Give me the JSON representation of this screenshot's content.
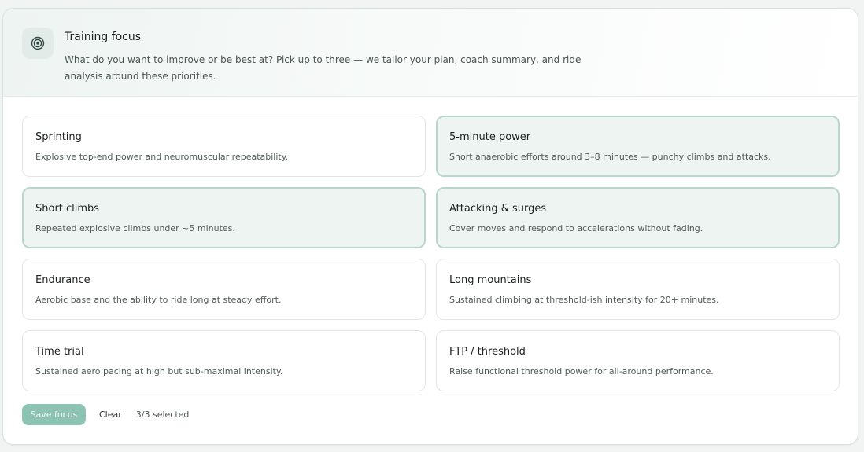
{
  "header": {
    "icon": "target-icon",
    "title": "Training focus",
    "description": "What do you want to improve or be best at? Pick up to three — we tailor your plan, coach summary, and ride analysis around these priorities."
  },
  "options": [
    {
      "title": "Sprinting",
      "description": "Explosive top-end power and neuromuscular repeatability.",
      "selected": false
    },
    {
      "title": "5-minute power",
      "description": "Short anaerobic efforts around 3–8 minutes — punchy climbs and attacks.",
      "selected": true
    },
    {
      "title": "Short climbs",
      "description": "Repeated explosive climbs under ~5 minutes.",
      "selected": true
    },
    {
      "title": "Attacking & surges",
      "description": "Cover moves and respond to accelerations without fading.",
      "selected": true
    },
    {
      "title": "Endurance",
      "description": "Aerobic base and the ability to ride long at steady effort.",
      "selected": false
    },
    {
      "title": "Long mountains",
      "description": "Sustained climbing at threshold-ish intensity for 20+ minutes.",
      "selected": false
    },
    {
      "title": "Time trial",
      "description": "Sustained aero pacing at high but sub-maximal intensity.",
      "selected": false
    },
    {
      "title": "FTP / threshold",
      "description": "Raise functional threshold power for all-around performance.",
      "selected": false
    }
  ],
  "actions": {
    "save_label": "Save focus",
    "clear_label": "Clear",
    "selected_count": "3/3 selected"
  },
  "colors": {
    "accent": "#8cc3b3",
    "selected_bg": "#eef4f2",
    "selected_border": "#b9d6cc"
  }
}
